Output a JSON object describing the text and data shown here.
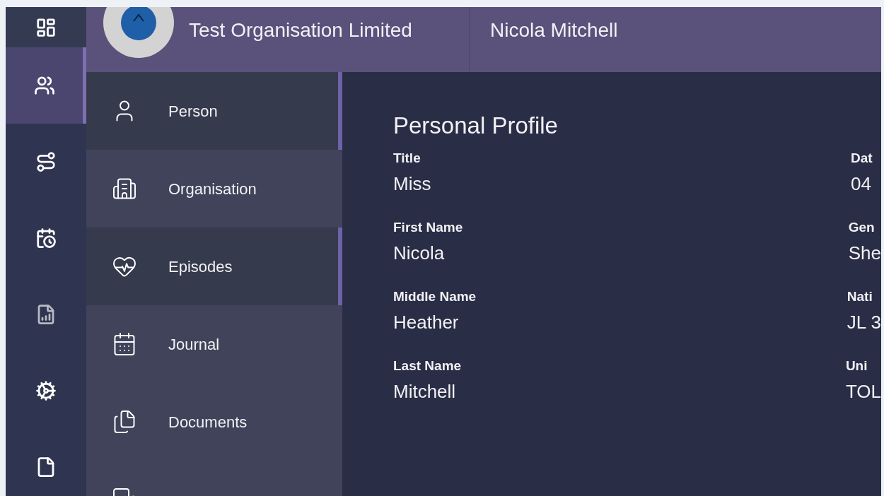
{
  "rail": [
    {
      "selected": false
    },
    {
      "selected": true
    },
    {
      "selected": false
    },
    {
      "selected": false
    },
    {
      "selected": false
    },
    {
      "selected": false
    },
    {
      "selected": false
    }
  ],
  "header": {
    "client": "Test Organisation Limited",
    "person": "Nicola Mitchell"
  },
  "submenu": [
    {
      "label": "Person",
      "highlighted": true
    },
    {
      "label": "Organisation",
      "highlighted": false
    },
    {
      "label": "Episodes",
      "highlighted": true
    },
    {
      "label": "Journal",
      "highlighted": false
    },
    {
      "label": "Documents",
      "highlighted": false
    },
    {
      "highlighted": false
    }
  ],
  "profile": {
    "title": "Personal Profile",
    "fields": [
      [
        {
          "label": "Title",
          "value": "Miss"
        },
        {
          "label": "Dat",
          "value": "04"
        }
      ],
      [
        {
          "label": "First Name",
          "value": "Nicola"
        },
        {
          "label": "Gen",
          "value": "She"
        }
      ],
      [
        {
          "label": "Middle Name",
          "value": "Heather"
        },
        {
          "label": "Nati",
          "value": "JL 3"
        }
      ],
      [
        {
          "label": "Last Name",
          "value": "Mitchell"
        },
        {
          "label": "Uni",
          "value": "TOL"
        }
      ]
    ]
  }
}
